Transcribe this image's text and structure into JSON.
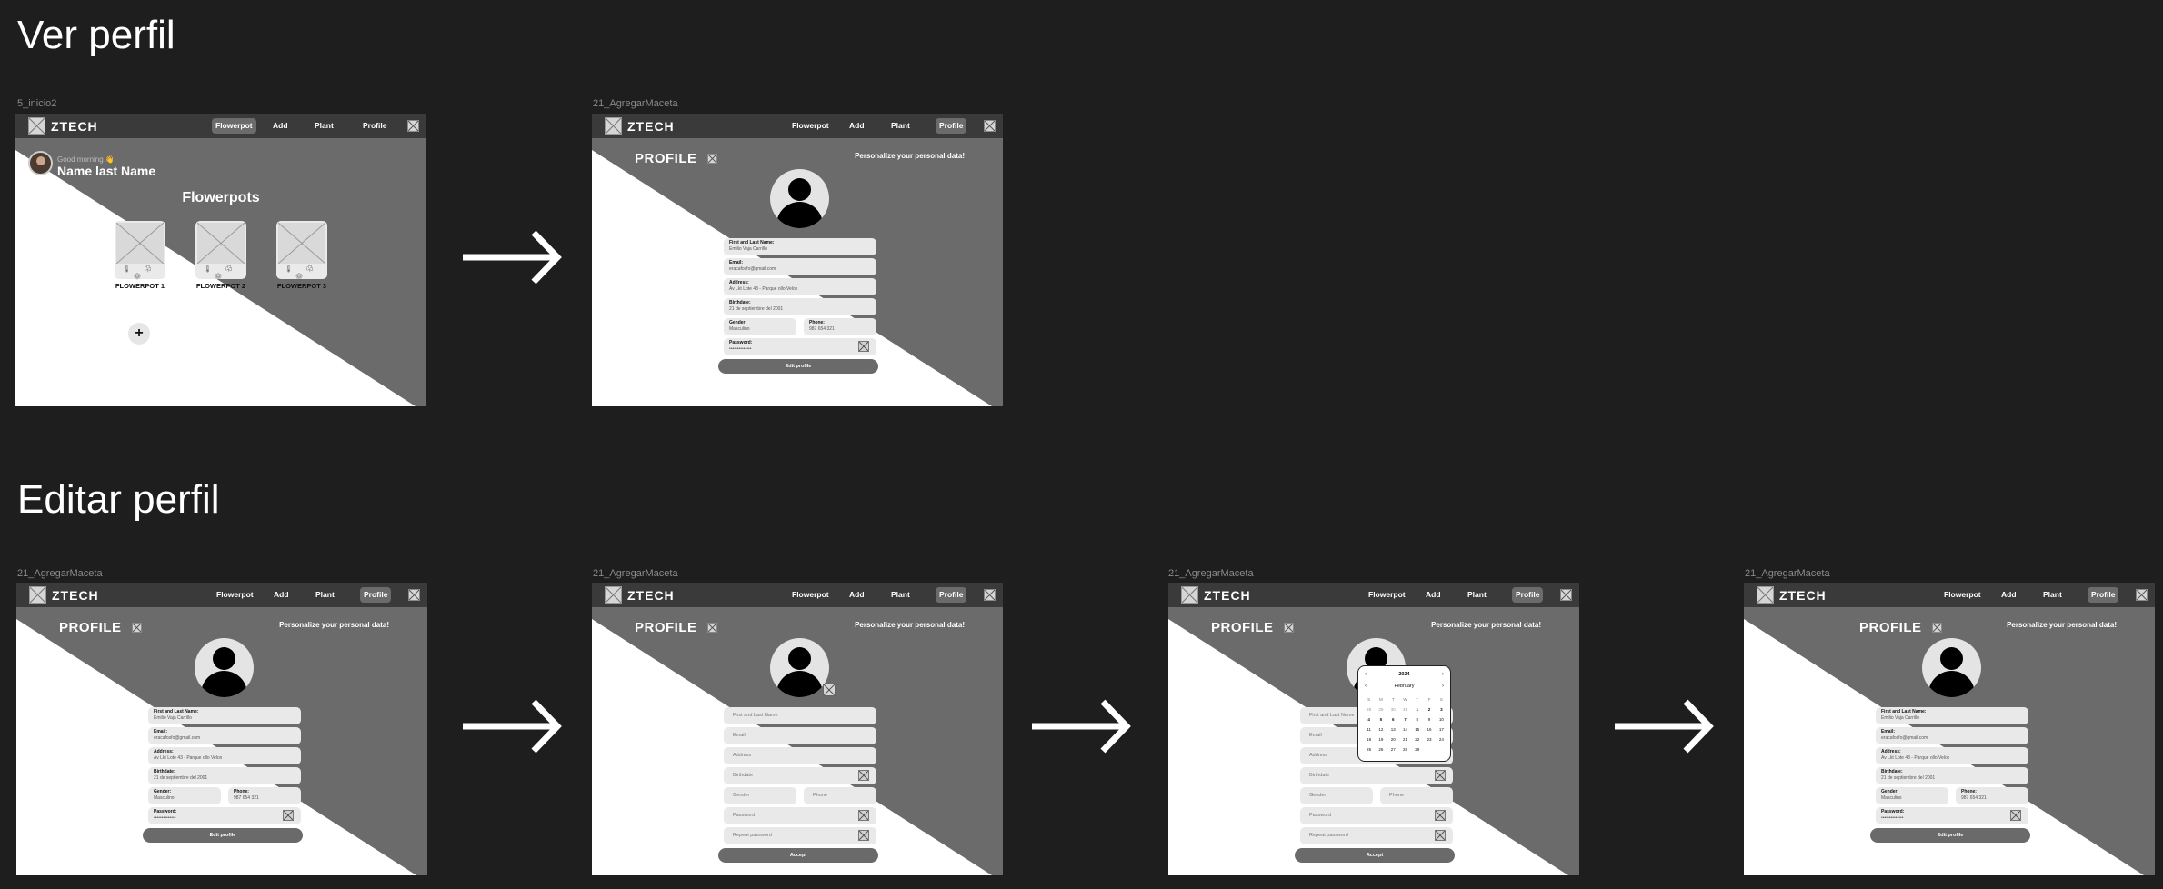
{
  "sections": {
    "view": {
      "title": "Ver perfil"
    },
    "edit": {
      "title": "Editar perfil"
    }
  },
  "frame_labels": {
    "home": "5_inicio2",
    "profile": "21_AgregarMaceta"
  },
  "nav": {
    "logo": "ZTECH",
    "items": [
      "Flowerpot",
      "Add",
      "Plant",
      "Profile"
    ]
  },
  "home": {
    "greeting": "Good morning 👋",
    "user_name": "Name last Name",
    "section_title": "Flowerpots",
    "pots": [
      {
        "label": "FLOWERPOT 1"
      },
      {
        "label": "FLOWERPOT 2"
      },
      {
        "label": "FLOWERPOT 3"
      }
    ],
    "pot_icons": "🌡 ☘ ✳",
    "add_symbol": "+"
  },
  "profile": {
    "title": "PROFILE",
    "subtitle": "Personalize your personal data!",
    "fields": {
      "name": {
        "label": "First and Last Name:",
        "value": "Emilio Vaja Carrillo"
      },
      "email": {
        "label": "Email:",
        "value": "eracafosfo@gmail.com"
      },
      "address": {
        "label": "Address:",
        "value": "Av Lkt Lote 43 - Parque ollo Velox"
      },
      "birthdate": {
        "label": "Birthdate:",
        "value": "21 de septiembre del 2001"
      },
      "gender": {
        "label": "Gender:",
        "value": "Masculino"
      },
      "phone": {
        "label": "Phone:",
        "value": "987 654 321"
      },
      "password": {
        "label": "Password:",
        "value": "••••••••••••••"
      }
    },
    "edit_button": "Edit profile"
  },
  "edit_form": {
    "placeholders": {
      "name": "First and Last Name",
      "email": "Email",
      "address": "Address",
      "birthdate": "Birthdate",
      "gender": "Gender",
      "phone": "Phone",
      "password": "Password",
      "repeat_password": "Repeat password"
    },
    "accept_button": "Accept"
  },
  "calendar": {
    "year": "2024",
    "month": "February",
    "weekdays": [
      "S",
      "M",
      "T",
      "W",
      "T",
      "F",
      "S"
    ],
    "days": [
      "28",
      "29",
      "30",
      "31",
      "1",
      "2",
      "3",
      "4",
      "5",
      "6",
      "7",
      "8",
      "9",
      "10",
      "11",
      "12",
      "13",
      "14",
      "15",
      "16",
      "17",
      "18",
      "19",
      "20",
      "21",
      "22",
      "23",
      "24",
      "25",
      "26",
      "27",
      "28",
      "29"
    ]
  },
  "colors": {
    "background": "#1e1e1e",
    "nav": "#3a3a3a",
    "diagonal_dark": "#6b6b6b",
    "field": "#e9e9e9"
  }
}
